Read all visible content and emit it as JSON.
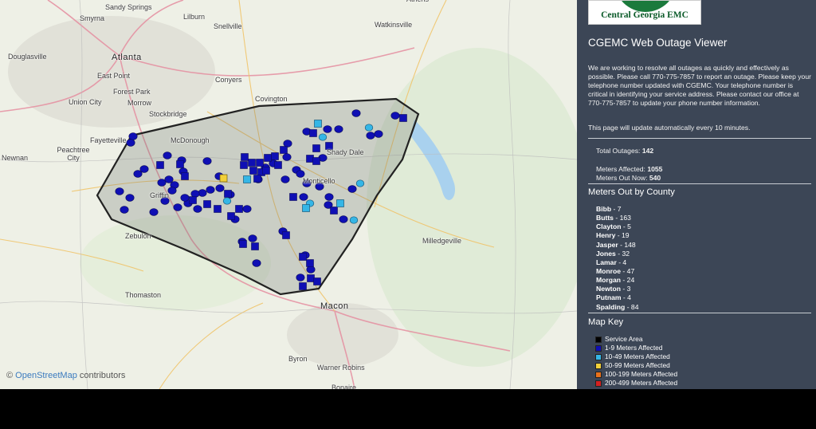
{
  "map": {
    "attribution_symbol": "©",
    "attribution_link": "OpenStreetMap",
    "attribution_suffix": "contributors",
    "cities": [
      {
        "name": "Sandy Springs",
        "big": false
      },
      {
        "name": "Lilburn",
        "big": false
      },
      {
        "name": "Smyrna",
        "big": false
      },
      {
        "name": "Snellville",
        "big": false
      },
      {
        "name": "Watkinsville",
        "big": false
      },
      {
        "name": "Douglasville",
        "big": false
      },
      {
        "name": "Atlanta",
        "big": true
      },
      {
        "name": "East Point",
        "big": false
      },
      {
        "name": "Conyers",
        "big": false
      },
      {
        "name": "Forest Park",
        "big": false
      },
      {
        "name": "Union City",
        "big": false
      },
      {
        "name": "Morrow",
        "big": false
      },
      {
        "name": "Covington",
        "big": false
      },
      {
        "name": "Stockbridge",
        "big": false
      },
      {
        "name": "Fayetteville",
        "big": false
      },
      {
        "name": "McDonough",
        "big": false
      },
      {
        "name": "Peachtree City",
        "big": false
      },
      {
        "name": "Newnan",
        "big": false
      },
      {
        "name": "Shady Dale",
        "big": false
      },
      {
        "name": "Monticello",
        "big": false
      },
      {
        "name": "Griffin",
        "big": false
      },
      {
        "name": "Zebulon",
        "big": false
      },
      {
        "name": "Milledgeville",
        "big": false
      },
      {
        "name": "Thomaston",
        "big": false
      },
      {
        "name": "Macon",
        "big": true
      },
      {
        "name": "Byron",
        "big": false
      },
      {
        "name": "Warner Robins",
        "big": false
      },
      {
        "name": "Bonaire",
        "big": false
      },
      {
        "name": "Athens",
        "big": false
      }
    ],
    "key_colors": {
      "service_area": "#000000",
      "m1_9": "#0f0fb4",
      "m10_49": "#35b6e6",
      "m50_99": "#f2d03a",
      "m100_199": "#e8711b",
      "m200_499": "#d42020"
    }
  },
  "panel": {
    "logo_text": "Central Georgia EMC",
    "title": "CGEMC Web Outage Viewer",
    "intro": "We are working to resolve all outages as quickly and effectively as possible. Please call 770-775-7857 to report an outage. Please keep your telephone number updated with CGEMC. Your telephone number is critical in identifying your service address. Please contact our office at 770-775-7857 to update your phone number information.",
    "refresh_note": "This page will update automatically every 10 minutes.",
    "total_outages_label": "Total Outages:",
    "total_outages": "142",
    "meters_affected_label": "Meters Affected:",
    "meters_affected": "1055",
    "meters_out_label": "Meters Out Now:",
    "meters_out": "540",
    "county_title": "Meters Out by County",
    "counties": [
      {
        "name": "Bibb",
        "count": "- 7"
      },
      {
        "name": "Butts",
        "count": "- 163"
      },
      {
        "name": "Clayton",
        "count": "- 5"
      },
      {
        "name": "Henry",
        "count": "- 19"
      },
      {
        "name": "Jasper",
        "count": "- 148"
      },
      {
        "name": "Jones",
        "count": "- 32"
      },
      {
        "name": "Lamar",
        "count": "- 4"
      },
      {
        "name": "Monroe",
        "count": "- 47"
      },
      {
        "name": "Morgan",
        "count": "- 24"
      },
      {
        "name": "Newton",
        "count": "- 3"
      },
      {
        "name": "Putnam",
        "count": "- 4"
      },
      {
        "name": "Spalding",
        "count": "- 84"
      }
    ],
    "key_title": "Map Key",
    "key": [
      {
        "label": "Service Area",
        "color": "#000000"
      },
      {
        "label": "1-9 Meters Affected",
        "color": "#0f0fb4"
      },
      {
        "label": "10-49 Meters Affected",
        "color": "#35b6e6"
      },
      {
        "label": "50-99 Meters Affected",
        "color": "#f2d03a"
      },
      {
        "label": "100-199 Meters Affected",
        "color": "#e8711b"
      },
      {
        "label": "200-499 Meters Affected",
        "color": "#d42020"
      }
    ]
  }
}
